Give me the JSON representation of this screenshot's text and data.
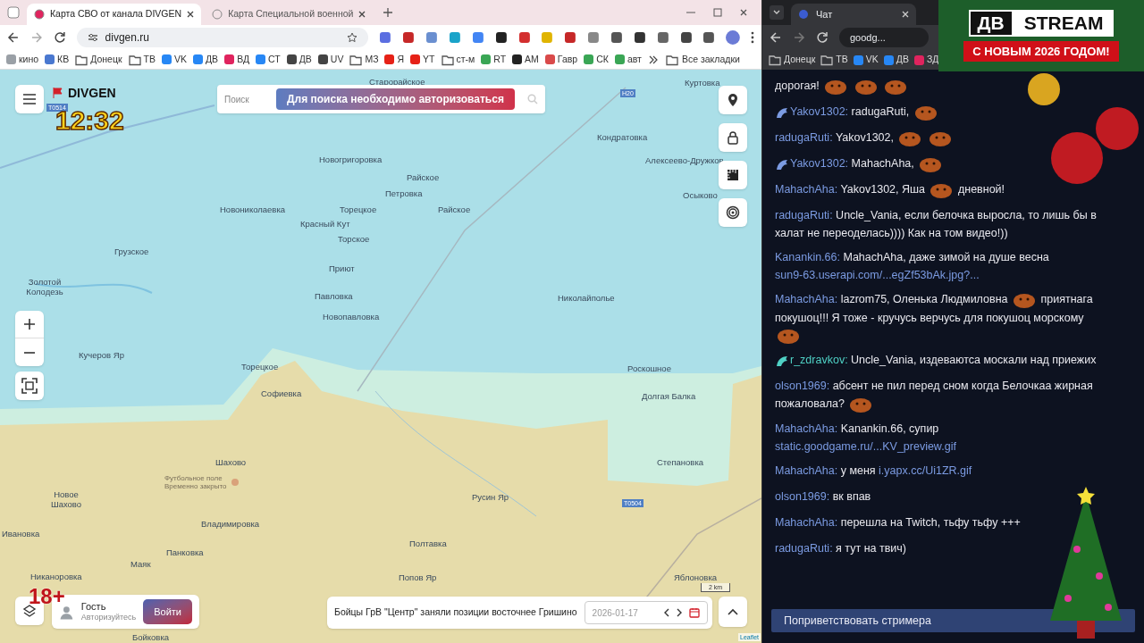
{
  "browser": {
    "tabs": [
      {
        "title": "Карта СВО от канала DIVGEN",
        "selected": true
      },
      {
        "title": "Карта Специальной военной",
        "selected": false
      }
    ],
    "address": "divgen.ru",
    "bookmarks": [
      {
        "kind": "site",
        "label": "кино",
        "color": "#9aa0a6"
      },
      {
        "kind": "site",
        "label": "КВ",
        "color": "#4a78d0"
      },
      {
        "kind": "folder",
        "label": "Донецк"
      },
      {
        "kind": "folder",
        "label": "ТВ"
      },
      {
        "kind": "site",
        "label": "VK",
        "color": "#2787f5"
      },
      {
        "kind": "site",
        "label": "ДВ",
        "color": "#2787f5"
      },
      {
        "kind": "site",
        "label": "ВД",
        "color": "#e0245e"
      },
      {
        "kind": "site",
        "label": "СТ",
        "color": "#2787f5"
      },
      {
        "kind": "site",
        "label": "ДВ",
        "color": "#444444"
      },
      {
        "kind": "site",
        "label": "UV",
        "color": "#444444"
      },
      {
        "kind": "folder",
        "label": "МЗ"
      },
      {
        "kind": "site",
        "label": "Я",
        "color": "#e62117"
      },
      {
        "kind": "site",
        "label": "YT",
        "color": "#e62117"
      },
      {
        "kind": "folder",
        "label": "ст-м"
      },
      {
        "kind": "site",
        "label": "RT",
        "color": "#3aa655"
      },
      {
        "kind": "site",
        "label": "АМ",
        "color": "#222222"
      },
      {
        "kind": "site",
        "label": "Гавр",
        "color": "#d94a4a"
      },
      {
        "kind": "site",
        "label": "СК",
        "color": "#3aa655"
      },
      {
        "kind": "site",
        "label": "авт",
        "color": "#3aa655"
      }
    ],
    "all_bookmarks": "Все закладки"
  },
  "map": {
    "search_placeholder": "Поиск",
    "search_notice": "Для поиска необходимо авторизоваться",
    "logo": "DIVGEN",
    "roads": [
      "T0514",
      "H20",
      "T0504"
    ],
    "places": [
      "Старорайское",
      "Куртовка",
      "Кондратовка",
      "Новогригоровка",
      "Алексеево-Дружков",
      "Райское",
      "Петровка",
      "Осыково",
      "Новониколаевка",
      "Торецкое",
      "Райское",
      "Красный Кут",
      "Торское",
      "Грузское",
      "Приют",
      "Золотой Колодезь",
      "Павловка",
      "Николайполье",
      "Новопавловка",
      "Кучеров Яр",
      "Торецкое",
      "Роскошное",
      "Софиевка",
      "Долгая Балка",
      "Шахово",
      "Степановка",
      "Новое Шахово",
      "Русин Яр",
      "Владимировка",
      "Ивановка",
      "Полтавка",
      "Панковка",
      "Маяк",
      "Никаноровка",
      "Попов Яр",
      "Яблоновка",
      "Бойковка"
    ],
    "poi": {
      "name": "Футбольное поле",
      "note": "Временно закрыто"
    },
    "user": {
      "name": "Гость",
      "hint": "Авторизуйтесь",
      "login": "Войти"
    },
    "news": "Бойцы ГрВ \"Центр\" заняли позиции восточнее Гришино",
    "date": "2026-01-17",
    "scale": "2 km",
    "attribution": "Leaflet"
  },
  "overlay": {
    "clock": "12:32",
    "age": "18+",
    "logo_left": "ДВ",
    "logo_right": "STREAM",
    "greeting": "С НОВЫМ 2026 ГОДОМ!"
  },
  "chat_window": {
    "tab": "Чат",
    "address": "goodg...",
    "bookmarks": [
      {
        "kind": "folder",
        "label": "Донецк"
      },
      {
        "kind": "folder",
        "label": "ТВ"
      },
      {
        "kind": "site",
        "label": "VK",
        "color": "#2787f5"
      },
      {
        "kind": "site",
        "label": "ДВ",
        "color": "#2787f5"
      },
      {
        "kind": "site",
        "label": "ЗД",
        "color": "#e0245e"
      }
    ]
  },
  "chat": {
    "messages": [
      {
        "badge": false,
        "segments": [
          {
            "kind": "text",
            "text": "дорогая!"
          },
          {
            "kind": "emote"
          },
          {
            "kind": "emote"
          },
          {
            "kind": "emote"
          }
        ]
      },
      {
        "author": "Yakov1302:",
        "color": "#7b9be2",
        "badge": true,
        "segments": [
          {
            "kind": "text",
            "text": "radugaRuti,"
          },
          {
            "kind": "emote"
          }
        ]
      },
      {
        "author": "radugaRuti:",
        "color": "#7b9be2",
        "badge": false,
        "segments": [
          {
            "kind": "text",
            "text": "Yakov1302,"
          },
          {
            "kind": "emote"
          },
          {
            "kind": "emote"
          }
        ]
      },
      {
        "author": "Yakov1302:",
        "color": "#7b9be2",
        "badge": true,
        "segments": [
          {
            "kind": "text",
            "text": "MahachAha,"
          },
          {
            "kind": "emote"
          }
        ]
      },
      {
        "author": "MahachAha:",
        "color": "#7b9be2",
        "badge": false,
        "segments": [
          {
            "kind": "text",
            "text": "Yakov1302, Яша"
          },
          {
            "kind": "emote"
          },
          {
            "kind": "text",
            "text": "дневной!"
          }
        ]
      },
      {
        "author": "radugaRuti:",
        "color": "#7b9be2",
        "badge": false,
        "segments": [
          {
            "kind": "text",
            "text": "Uncle_Vania, если белочка выросла, то лишь бы в халат не переоделась)))) Как на том видео!))"
          }
        ]
      },
      {
        "author": "Kanankin.66:",
        "color": "#7b9be2",
        "badge": false,
        "segments": [
          {
            "kind": "text",
            "text": "MahachAha, даже зимой на душе весна"
          },
          {
            "kind": "link",
            "text": "sun9-63.userapi.com/...egZf53bAk.jpg?..."
          }
        ]
      },
      {
        "author": "MahachAha:",
        "color": "#7b9be2",
        "badge": false,
        "segments": [
          {
            "kind": "text",
            "text": "lazrom75, Оленька Людмиловна"
          },
          {
            "kind": "emote"
          },
          {
            "kind": "text",
            "text": "приятнага покушоц!!! Я тоже - кручусь верчусь для покушоц морскому"
          },
          {
            "kind": "emote"
          }
        ]
      },
      {
        "author": "r_zdravkov:",
        "color": "#4fd1c5",
        "badge": true,
        "segments": [
          {
            "kind": "text",
            "text": "Uncle_Vania, издеваютса москали над приежих"
          }
        ]
      },
      {
        "author": "olson1969:",
        "color": "#7b9be2",
        "badge": false,
        "segments": [
          {
            "kind": "text",
            "text": "абсент не пил перед сном когда Белочкаа жирная пожаловала?"
          },
          {
            "kind": "emote"
          }
        ]
      },
      {
        "author": "MahachAha:",
        "color": "#7b9be2",
        "badge": false,
        "segments": [
          {
            "kind": "text",
            "text": "Kanankin.66, супир"
          },
          {
            "kind": "link",
            "text": "static.goodgame.ru/...KV_preview.gif"
          }
        ]
      },
      {
        "author": "MahachAha:",
        "color": "#7b9be2",
        "badge": false,
        "segments": [
          {
            "kind": "text",
            "text": "у меня"
          },
          {
            "kind": "link",
            "text": "i.yapx.cc/Ui1ZR.gif"
          }
        ]
      },
      {
        "author": "olson1969:",
        "color": "#7b9be2",
        "badge": false,
        "segments": [
          {
            "kind": "text",
            "text": "вк впав"
          }
        ]
      },
      {
        "author": "MahachAha:",
        "color": "#7b9be2",
        "badge": false,
        "segments": [
          {
            "kind": "text",
            "text": "перешла на Twitch, тьфу тьфу +++"
          }
        ]
      },
      {
        "author": "radugaRuti:",
        "color": "#7b9be2",
        "badge": false,
        "segments": [
          {
            "kind": "text",
            "text": "я тут на твич)"
          }
        ]
      }
    ],
    "greet_button": "Поприветствовать стримера"
  }
}
